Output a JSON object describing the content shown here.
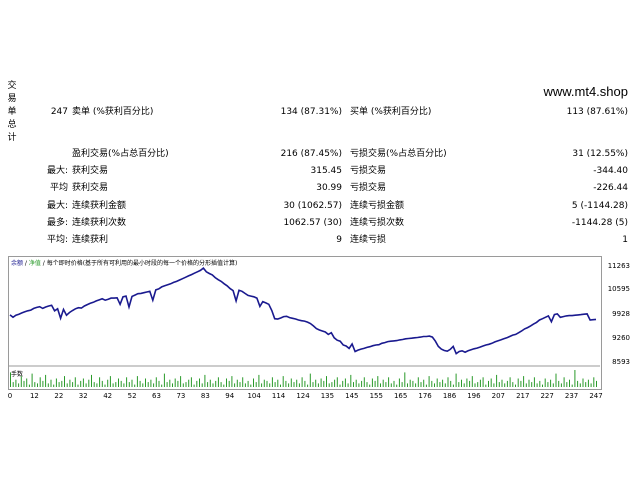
{
  "side_label": [
    "交",
    "易",
    "单",
    "总",
    "计"
  ],
  "site": "www.mt4.shop",
  "rows": [
    {
      "c1": "247",
      "c2": "卖单 (%获利百分比)",
      "c3": "134 (87.31%)",
      "c4": "买单 (%获利百分比)",
      "c5": "113 (87.61%)"
    },
    {
      "c1": "",
      "c2": "盈利交易(%占总百分比)",
      "c3": "216 (87.45%)",
      "c4": "亏损交易(%占总百分比)",
      "c5": "31 (12.55%)"
    },
    {
      "c1": "最大:",
      "c2": "获利交易",
      "c3": "315.45",
      "c4": "亏损交易",
      "c5": "-344.40"
    },
    {
      "c1": "平均",
      "c2": "获利交易",
      "c3": "30.99",
      "c4": "亏损交易",
      "c5": "-226.44"
    },
    {
      "c1": "最大:",
      "c2": "连续获利金额",
      "c3": "30 (1062.57)",
      "c4": "连续亏损金额",
      "c5": "5 (-1144.28)"
    },
    {
      "c1": "最多:",
      "c2": "连续获利次数",
      "c3": "1062.57 (30)",
      "c4": "连续亏损次数",
      "c5": "-1144.28 (5)"
    },
    {
      "c1": "平均:",
      "c2": "连续获利",
      "c3": "9",
      "c4": "连续亏损",
      "c5": "1"
    }
  ],
  "chart_legend": {
    "balance": "余额",
    "equity": "净值",
    "desc": "每个即时价格(基于所有可利用的最小时段的每一个价格的分形插值计算)"
  },
  "volume_label": "手数",
  "chart_data": {
    "type": "line",
    "ylim": [
      8593,
      11400
    ],
    "y_ticks": [
      "11263",
      "10595",
      "9928",
      "9260",
      "8593"
    ],
    "x_ticks": [
      "0",
      "12",
      "22",
      "32",
      "42",
      "52",
      "63",
      "73",
      "83",
      "94",
      "104",
      "114",
      "124",
      "135",
      "145",
      "155",
      "165",
      "176",
      "186",
      "196",
      "207",
      "217",
      "227",
      "237",
      "247"
    ],
    "series": [
      {
        "values": [
          9970,
          9900,
          9960,
          9990,
          10030,
          10060,
          10090,
          10110,
          10160,
          10190,
          10210,
          10160,
          10200,
          10230,
          10250,
          10090,
          10150,
          9870,
          10130,
          9960,
          10040,
          10100,
          10150,
          10180,
          10170,
          10230,
          10270,
          10310,
          10340,
          10380,
          10410,
          10440,
          10400,
          10430,
          10460,
          10460,
          10470,
          10280,
          10500,
          10520,
          10200,
          10510,
          10550,
          10590,
          10600,
          10620,
          10640,
          10660,
          10400,
          10700,
          10730,
          10790,
          10820,
          10850,
          10880,
          10920,
          10950,
          10990,
          11030,
          11070,
          11110,
          11150,
          11190,
          11230,
          11270,
          11340,
          11230,
          11180,
          11140,
          11060,
          11000,
          10950,
          10880,
          10820,
          10740,
          10680,
          10380,
          10690,
          10660,
          10600,
          10540,
          10520,
          10500,
          10460,
          10220,
          10360,
          10320,
          10280,
          10100,
          9860,
          9850,
          9880,
          9920,
          9930,
          9890,
          9870,
          9850,
          9820,
          9800,
          9790,
          9760,
          9720,
          9650,
          9570,
          9530,
          9500,
          9470,
          9400,
          9450,
          9300,
          9230,
          9200,
          9090,
          9060,
          8990,
          9120,
          8900,
          8940,
          8970,
          8990,
          9020,
          9040,
          9070,
          9090,
          9100,
          9140,
          9160,
          9190,
          9200,
          9210,
          9220,
          9240,
          9250,
          9270,
          9280,
          9290,
          9300,
          9310,
          9320,
          9340,
          9340,
          9350,
          9320,
          9200,
          9050,
          8970,
          8930,
          8910,
          8960,
          9050,
          8840,
          8900,
          8920,
          8880,
          8920,
          8950,
          8980,
          9000,
          9030,
          9060,
          9090,
          9110,
          9140,
          9180,
          9210,
          9240,
          9270,
          9300,
          9340,
          9380,
          9400,
          9450,
          9500,
          9560,
          9600,
          9650,
          9700,
          9750,
          9820,
          9860,
          9900,
          9940,
          9770,
          9980,
          10000,
          9900,
          9920,
          9940,
          9950,
          9950,
          9960,
          9970,
          9980,
          9990,
          10000,
          9820,
          9830,
          9840
        ]
      }
    ],
    "volumes": [
      12,
      4,
      6,
      3,
      9,
      5,
      7,
      2,
      11,
      4,
      3,
      8,
      5,
      10,
      3,
      6,
      2,
      7,
      4,
      5,
      9,
      3,
      6,
      4,
      8,
      2,
      5,
      7,
      3,
      6,
      10,
      4,
      3,
      8,
      5,
      2,
      6,
      9,
      3,
      4,
      7,
      5,
      3,
      8,
      4,
      6,
      2,
      9,
      5,
      3,
      7,
      4,
      6,
      3,
      8,
      5,
      2,
      11,
      4,
      6,
      3,
      7,
      5,
      9,
      3,
      4,
      6,
      8,
      2,
      5,
      7,
      3,
      10,
      4,
      6,
      3,
      5,
      8,
      4,
      2,
      7,
      5,
      9,
      3,
      6,
      4,
      8,
      3,
      5,
      2,
      7,
      4,
      10,
      3,
      6,
      5,
      3,
      8,
      4,
      6,
      2,
      9,
      5,
      3,
      7,
      4,
      6,
      3,
      8,
      5,
      2,
      11,
      4,
      6,
      3,
      7,
      5,
      9,
      3,
      4,
      6,
      8,
      2,
      5,
      7,
      3,
      10,
      4,
      6,
      3,
      5,
      8,
      4,
      2,
      7,
      5,
      9,
      3,
      6,
      4,
      8,
      3,
      5,
      2,
      7,
      4,
      12,
      3,
      6,
      5,
      3,
      8,
      4,
      6,
      2,
      9,
      5,
      3,
      7,
      4,
      6,
      3,
      8,
      5,
      2,
      11,
      4,
      6,
      3,
      7,
      5,
      9,
      3,
      4,
      6,
      8,
      2,
      5,
      7,
      3,
      10,
      4,
      6,
      3,
      5,
      8,
      4,
      2,
      7,
      5,
      9,
      3,
      6,
      4,
      8,
      3,
      5,
      2,
      7,
      4,
      6,
      3,
      11,
      5,
      3,
      8,
      4,
      6,
      2,
      14,
      5,
      3,
      7,
      4,
      6,
      3,
      8,
      5
    ]
  }
}
